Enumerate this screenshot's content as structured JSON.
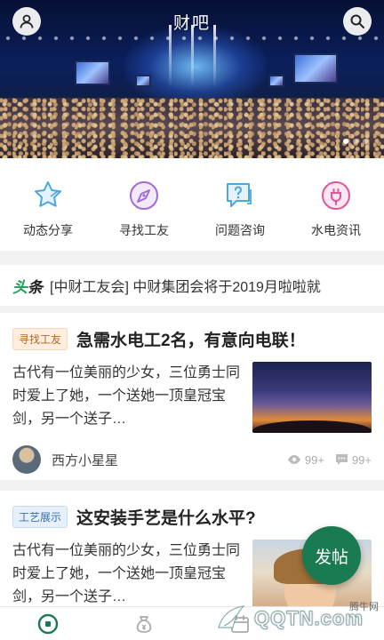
{
  "header": {
    "title": "财吧"
  },
  "categories": [
    {
      "label": "动态分享",
      "icon": "star-icon",
      "color": "#4aa7e0"
    },
    {
      "label": "寻找工友",
      "icon": "compass-icon",
      "color": "#a06ad8"
    },
    {
      "label": "问题咨询",
      "icon": "question-chat-icon",
      "color": "#4aa7e0"
    },
    {
      "label": "水电资讯",
      "icon": "plug-icon",
      "color": "#e0559a"
    }
  ],
  "ticker": {
    "tag_a": "头",
    "tag_b": "条",
    "text": "[中财工友会] 中财集团会将于2019月啦啦就"
  },
  "posts": [
    {
      "tag": "寻找工友",
      "title": "急需水电工2名，有意向电联！",
      "excerpt": "古代有一位美丽的少女，三位勇士同时爱上了她，一个送她一顶皇冠宝剑，另一个送子…",
      "author": "西方小星星",
      "views": "99+",
      "comments": "99+"
    },
    {
      "tag": "工艺展示",
      "title": "这安装手艺是什么水平?",
      "excerpt": "古代有一位美丽的少女，三位勇士同时爱上了她，一个送她一顶皇冠宝剑，另一个送子…"
    }
  ],
  "fab": {
    "label": "发帖"
  },
  "watermark": {
    "site": "腾牛网",
    "brand": "QQTN.com"
  },
  "colors": {
    "accent": "#1a7a52",
    "ticker_green": "#1ea05a"
  }
}
